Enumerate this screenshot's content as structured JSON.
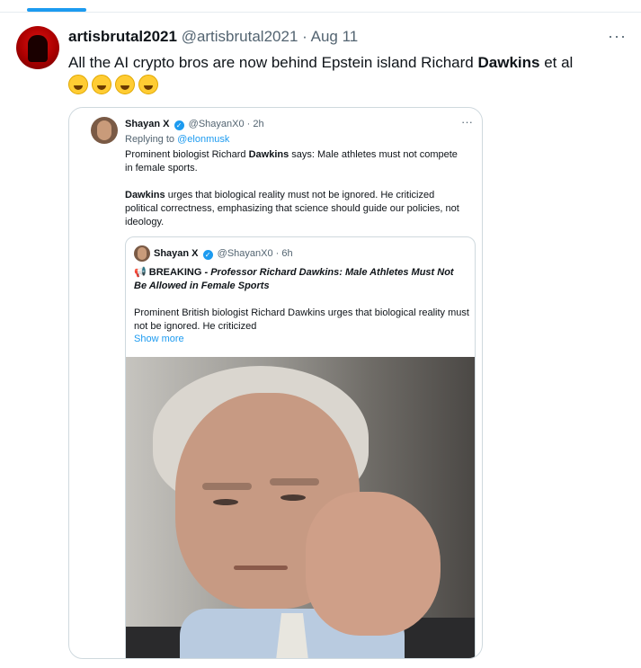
{
  "tweet": {
    "display_name": "artisbrutal2021",
    "handle": "@artisbrutal2021",
    "separator": "·",
    "date": "Aug 11",
    "text_before": "All the AI crypto bros are now behind Epstein island Richard ",
    "text_bold": "Dawkins",
    "text_after": " et al",
    "emojis": [
      "grinning-squinting-face",
      "grinning-sweat-face",
      "tears-of-joy-face",
      "rolling-on-floor-laughing-face"
    ],
    "more": "···"
  },
  "quoted": {
    "display_name": "Shayan X",
    "handle": "@ShayanX0",
    "separator": "·",
    "time": "2h",
    "replying_to_label": "Replying to",
    "replying_to_handle": "@elonmusk",
    "p1_before": "Prominent biologist Richard ",
    "p1_bold": "Dawkins",
    "p1_after": " says: Male athletes must not compete in female sports.",
    "p2_bold": "Dawkins",
    "p2_after": " urges that biological reality must not be ignored. He criticized political correctness, emphasizing that science should guide our policies, not ideology.",
    "more": "···"
  },
  "inner": {
    "display_name": "Shayan X",
    "handle": "@ShayanX0",
    "separator": "·",
    "time": "6h",
    "breaking_icon": "megaphone-icon",
    "breaking_label": "BREAKING",
    "breaking_dash": " - ",
    "breaking_headline": "Professor Richard Dawkins: Male Athletes Must Not Be Allowed in Female Sports",
    "text": "Prominent British biologist Richard Dawkins urges that biological reality must not be ignored. He criticized",
    "show_more": "Show more"
  },
  "colors": {
    "link": "#1d9bf0",
    "muted": "#536471",
    "border": "#cfd9de",
    "text": "#0f1419"
  }
}
